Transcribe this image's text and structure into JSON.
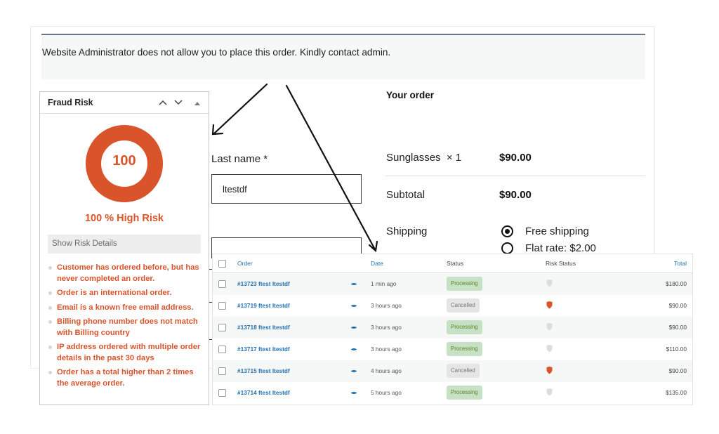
{
  "checkout": {
    "notice": "Website Administrator does not allow you to place this order. Kindly contact admin.",
    "last_name_label": "Last name *",
    "last_name_value": "ltestdf",
    "your_order_title": "Your order",
    "item_label": "Sunglasses  × 1",
    "item_price": "$90.00",
    "subtotal_label": "Subtotal",
    "subtotal_value": "$90.00",
    "shipping_label": "Shipping",
    "shipping_options": [
      {
        "label": "Free shipping",
        "selected": true
      },
      {
        "label": "Flat rate: $2.00",
        "selected": false
      }
    ]
  },
  "fraud_panel": {
    "title": "Fraud Risk",
    "move_up_icon": "chevron-up-icon",
    "move_down_icon": "chevron-down-icon",
    "toggle_icon": "triangle-up-icon",
    "score": "100",
    "score_fraction": 1.0,
    "risk_label": "100 % High Risk",
    "show_details_label": "Show Risk Details",
    "accent_color": "#d9532b",
    "reasons": [
      "Customer has ordered before, but has never completed an order.",
      "Order is an international order.",
      "Email is a known free email address.",
      "Billing phone number does not match with Billing country",
      "IP address ordered with multiple order details in the past 30 days",
      "Order has a total higher than 2 times the average order."
    ]
  },
  "orders_table": {
    "headers": {
      "order": "Order",
      "date": "Date",
      "status": "Status",
      "risk_status": "Risk Status",
      "total": "Total"
    },
    "rows": [
      {
        "order": "#13723 ftest ltestdf",
        "date": "1 min ago",
        "status": "Processing",
        "risk": "low",
        "total": "$180.00"
      },
      {
        "order": "#13719 ftest ltestdf",
        "date": "3 hours ago",
        "status": "Cancelled",
        "risk": "high",
        "total": "$90.00"
      },
      {
        "order": "#13718 ftest ltestdf",
        "date": "3 hours ago",
        "status": "Processing",
        "risk": "low",
        "total": "$90.00"
      },
      {
        "order": "#13717 ftest ltestdf",
        "date": "3 hours ago",
        "status": "Processing",
        "risk": "low",
        "total": "$110.00"
      },
      {
        "order": "#13715 ftest ltestdf",
        "date": "4 hours ago",
        "status": "Cancelled",
        "risk": "high",
        "total": "$90.00"
      },
      {
        "order": "#13714 ftest ltestdf",
        "date": "5 hours ago",
        "status": "Processing",
        "risk": "low",
        "total": "$135.00"
      }
    ],
    "colors": {
      "link": "#2271b1",
      "risk_high": "#d9532b",
      "risk_low": "#dcdcdc",
      "processing_bg": "#c6e1c6",
      "processing_text": "#5b841b",
      "cancelled_bg": "#e5e5e5"
    }
  }
}
